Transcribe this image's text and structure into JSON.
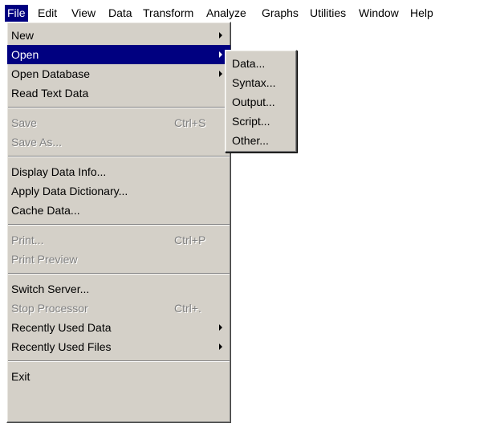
{
  "menubar": {
    "items": [
      {
        "label": "File",
        "active": true
      },
      {
        "label": "Edit"
      },
      {
        "label": "View"
      },
      {
        "label": "Data"
      },
      {
        "label": "Transform"
      },
      {
        "label": "Analyze"
      },
      {
        "label": "Graphs"
      },
      {
        "label": "Utilities"
      },
      {
        "label": "Window"
      },
      {
        "label": "Help"
      }
    ]
  },
  "file_menu": {
    "items": [
      {
        "label": "New",
        "has_submenu": true
      },
      {
        "label": "Open",
        "has_submenu": true,
        "highlighted": true
      },
      {
        "label": "Open Database",
        "has_submenu": true
      },
      {
        "label": "Read Text Data"
      },
      {
        "label": "Save",
        "shortcut": "Ctrl+S",
        "disabled": true
      },
      {
        "label": "Save As...",
        "disabled": true
      },
      {
        "label": "Display Data Info..."
      },
      {
        "label": "Apply Data Dictionary..."
      },
      {
        "label": "Cache Data..."
      },
      {
        "label": "Print...",
        "shortcut": "Ctrl+P",
        "disabled": true
      },
      {
        "label": "Print Preview",
        "disabled": true
      },
      {
        "label": "Switch Server..."
      },
      {
        "label": "Stop Processor",
        "shortcut": "Ctrl+.",
        "disabled": true
      },
      {
        "label": "Recently Used Data",
        "has_submenu": true
      },
      {
        "label": "Recently Used Files",
        "has_submenu": true
      },
      {
        "label": "Exit"
      }
    ]
  },
  "open_submenu": {
    "items": [
      {
        "label": "Data..."
      },
      {
        "label": "Syntax..."
      },
      {
        "label": "Output..."
      },
      {
        "label": "Script..."
      },
      {
        "label": "Other..."
      }
    ]
  },
  "colors": {
    "menu_background": "#d4d0c8",
    "highlight": "#000080",
    "disabled_text": "#808080"
  },
  "icons": {
    "submenu_arrow": "submenu-arrow-icon"
  }
}
